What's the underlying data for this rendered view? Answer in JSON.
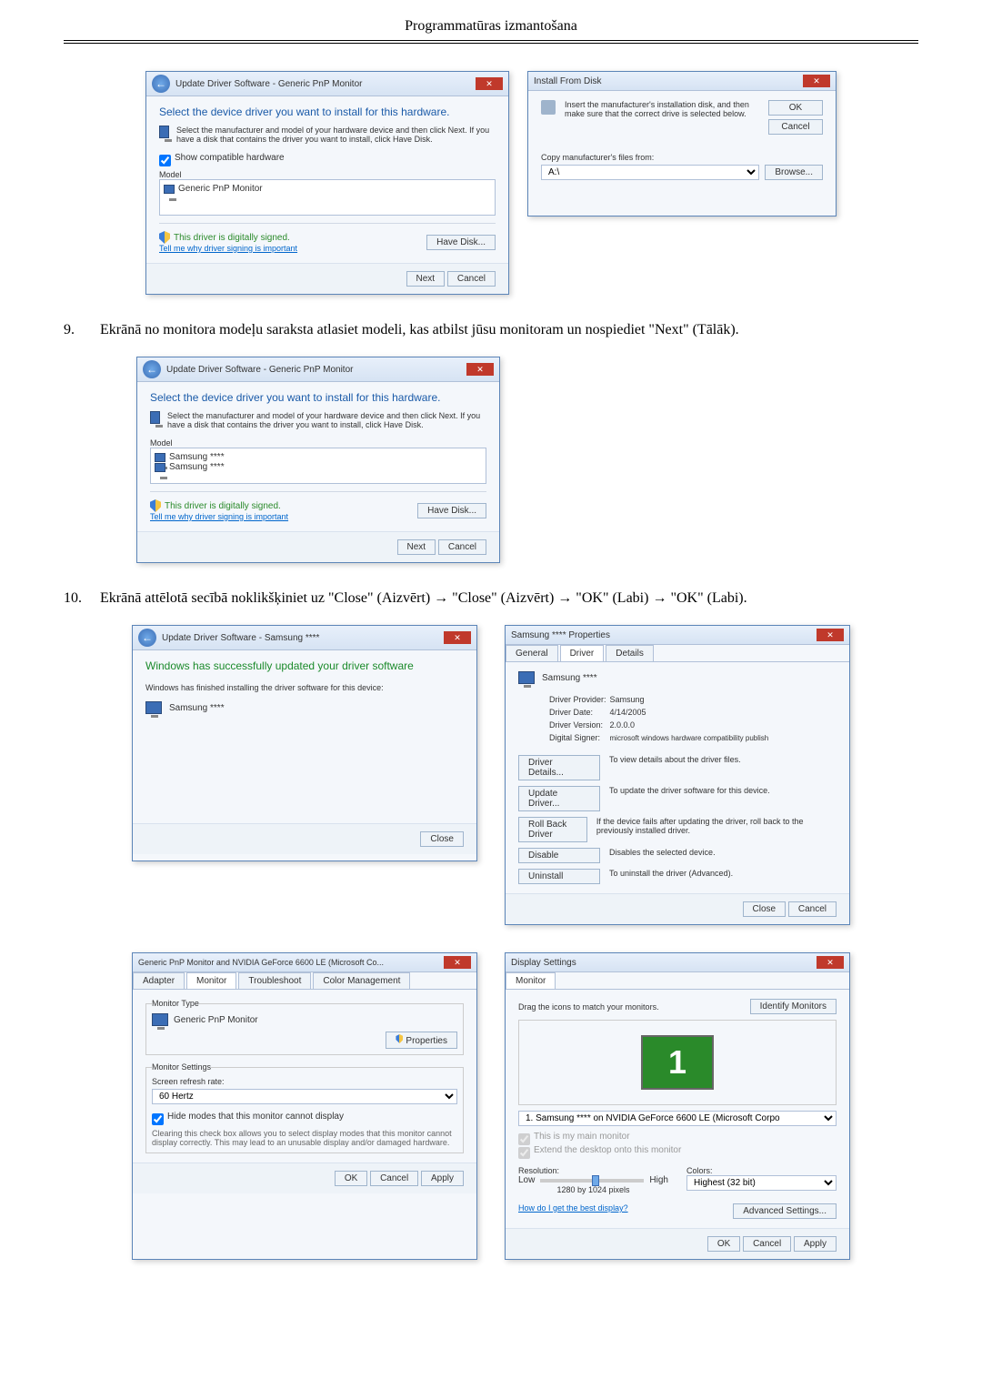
{
  "header": {
    "title": "Programmatūras izmantošana"
  },
  "step9": {
    "num": "9.",
    "text": "Ekrānā no monitora modeļu saraksta atlasiet modeli, kas atbilst jūsu monitoram un nospiediet \"Next\" (Tālāk)."
  },
  "step10": {
    "num": "10.",
    "text": "Ekrānā attēlotā secībā noklikšķiniet uz \"Close\" (Aizvērt) → \"Close\" (Aizvērt) → \"OK\" (Labi) → \"OK\" (Labi)."
  },
  "updateDialog1": {
    "title": "Update Driver Software - Generic PnP Monitor",
    "heading": "Select the device driver you want to install for this hardware.",
    "instruction": "Select the manufacturer and model of your hardware device and then click Next. If you have a disk that contains the driver you want to install, click Have Disk.",
    "showCompat": "Show compatible hardware",
    "modelLabel": "Model",
    "modelItem": "Generic PnP Monitor",
    "signed": "This driver is digitally signed.",
    "signedLink": "Tell me why driver signing is important",
    "haveDisk": "Have Disk...",
    "next": "Next",
    "cancel": "Cancel"
  },
  "installFromDisk": {
    "title": "Install From Disk",
    "instruction": "Insert the manufacturer's installation disk, and then make sure that the correct drive is selected below.",
    "ok": "OK",
    "cancel": "Cancel",
    "copyLabel": "Copy manufacturer's files from:",
    "path": "A:\\",
    "browse": "Browse..."
  },
  "updateDialog2": {
    "title": "Update Driver Software - Generic PnP Monitor",
    "heading": "Select the device driver you want to install for this hardware.",
    "instruction": "Select the manufacturer and model of your hardware device and then click Next. If you have a disk that contains the driver you want to install, click Have Disk.",
    "modelLabel": "Model",
    "item1": "Samsung ****",
    "item2": "Samsung ****",
    "signed": "This driver is digitally signed.",
    "signedLink": "Tell me why driver signing is important",
    "haveDisk": "Have Disk...",
    "next": "Next",
    "cancel": "Cancel"
  },
  "updateDone": {
    "title": "Update Driver Software - Samsung ****",
    "heading": "Windows has successfully updated your driver software",
    "sub": "Windows has finished installing the driver software for this device:",
    "device": "Samsung ****",
    "close": "Close"
  },
  "propsDialog": {
    "title": "Samsung **** Properties",
    "tabs": {
      "general": "General",
      "driver": "Driver",
      "details": "Details"
    },
    "device": "Samsung ****",
    "provLabel": "Driver Provider:",
    "provVal": "Samsung",
    "dateLabel": "Driver Date:",
    "dateVal": "4/14/2005",
    "verLabel": "Driver Version:",
    "verVal": "2.0.0.0",
    "signerLabel": "Digital Signer:",
    "signerVal": "microsoft windows hardware compatibility publish",
    "btnDetails": "Driver Details...",
    "btnDetailsDesc": "To view details about the driver files.",
    "btnUpdate": "Update Driver...",
    "btnUpdateDesc": "To update the driver software for this device.",
    "btnRollback": "Roll Back Driver",
    "btnRollbackDesc": "If the device fails after updating the driver, roll back to the previously installed driver.",
    "btnDisable": "Disable",
    "btnDisableDesc": "Disables the selected device.",
    "btnUninstall": "Uninstall",
    "btnUninstallDesc": "To uninstall the driver (Advanced).",
    "close": "Close",
    "cancel": "Cancel"
  },
  "monitorProps": {
    "title": "Generic PnP Monitor and NVIDIA GeForce 6600 LE (Microsoft Co...",
    "tabs": {
      "adapter": "Adapter",
      "monitor": "Monitor",
      "troubleshoot": "Troubleshoot",
      "color": "Color Management"
    },
    "monType": "Monitor Type",
    "monName": "Generic PnP Monitor",
    "propsBtn": "Properties",
    "settings": "Monitor Settings",
    "refreshLbl": "Screen refresh rate:",
    "refreshVal": "60 Hertz",
    "hideChk": "Hide modes that this monitor cannot display",
    "hideDesc": "Clearing this check box allows you to select display modes that this monitor cannot display correctly. This may lead to an unusable display and/or damaged hardware.",
    "ok": "OK",
    "cancel": "Cancel",
    "apply": "Apply"
  },
  "displaySettings": {
    "title": "Display Settings",
    "tab": "Monitor",
    "drag": "Drag the icons to match your monitors.",
    "identify": "Identify Monitors",
    "monNum": "1",
    "monSel": "1. Samsung **** on NVIDIA GeForce 6600 LE (Microsoft Corpo",
    "main": "This is my main monitor",
    "extend": "Extend the desktop onto this monitor",
    "resLabel": "Resolution:",
    "low": "Low",
    "high": "High",
    "resVal": "1280 by 1024 pixels",
    "colorsLabel": "Colors:",
    "colorsVal": "Highest (32 bit)",
    "bestLink": "How do I get the best display?",
    "advBtn": "Advanced Settings...",
    "ok": "OK",
    "cancel": "Cancel",
    "apply": "Apply"
  }
}
